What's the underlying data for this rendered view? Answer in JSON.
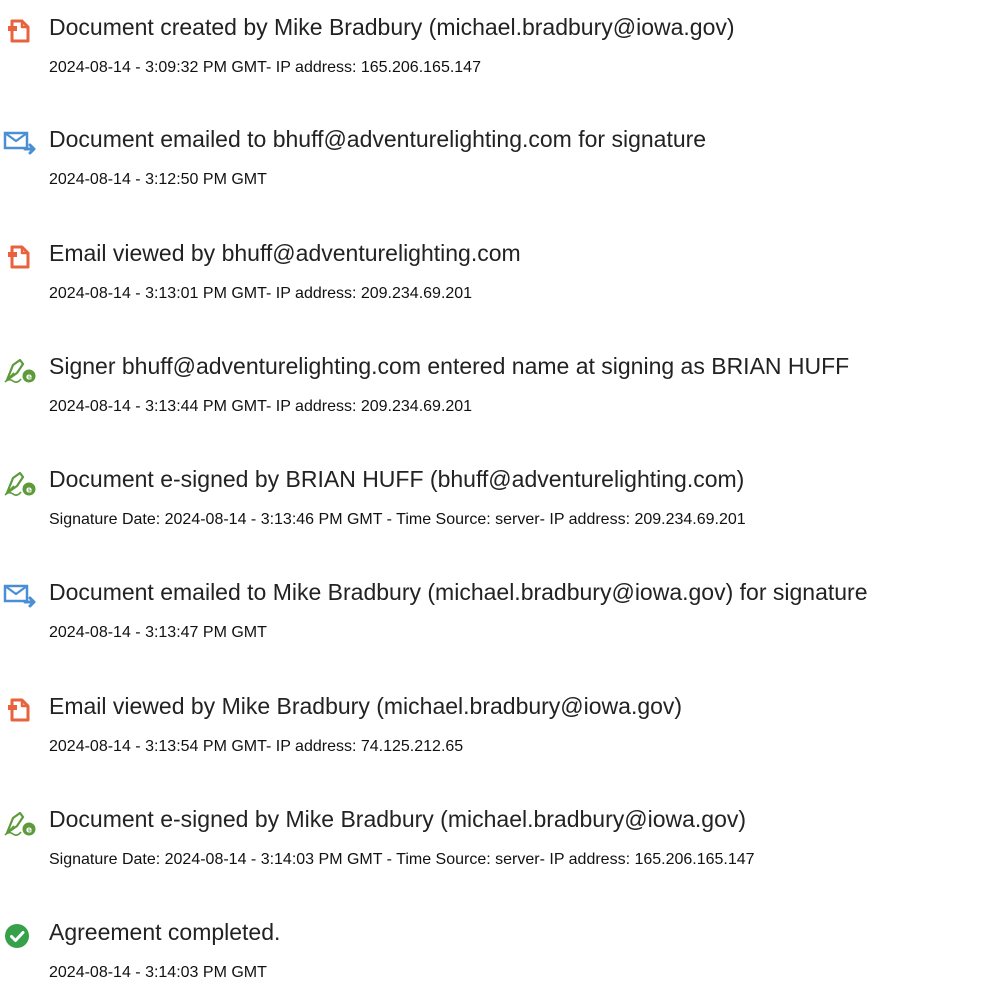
{
  "colors": {
    "doc_icon": "#e8623e",
    "email_icon": "#4a8fd6",
    "sign_icon": "#5c9a3a",
    "complete_icon": "#36a14a",
    "text": "#222222"
  },
  "entries": [
    {
      "icon": "document-icon",
      "title": "Document created by Mike Bradbury (michael.bradbury@iowa.gov)",
      "detail": "2024-08-14 - 3:09:32 PM GMT- IP address: 165.206.165.147"
    },
    {
      "icon": "email-icon",
      "title": "Document emailed to bhuff@adventurelighting.com for signature",
      "detail": "2024-08-14 - 3:12:50 PM GMT"
    },
    {
      "icon": "document-icon",
      "title": "Email viewed by bhuff@adventurelighting.com",
      "detail": "2024-08-14 - 3:13:01 PM GMT- IP address: 209.234.69.201"
    },
    {
      "icon": "signature-pen-icon",
      "title": "Signer bhuff@adventurelighting.com entered name at signing as BRIAN HUFF",
      "detail": "2024-08-14 - 3:13:44 PM GMT- IP address: 209.234.69.201"
    },
    {
      "icon": "signature-pen-icon",
      "title": "Document e-signed by BRIAN HUFF (bhuff@adventurelighting.com)",
      "detail": "Signature Date: 2024-08-14 - 3:13:46 PM GMT - Time Source: server- IP address: 209.234.69.201"
    },
    {
      "icon": "email-icon",
      "title": "Document emailed to Mike Bradbury (michael.bradbury@iowa.gov) for signature",
      "detail": "2024-08-14 - 3:13:47 PM GMT"
    },
    {
      "icon": "document-icon",
      "title": "Email viewed by Mike Bradbury (michael.bradbury@iowa.gov)",
      "detail": "2024-08-14 - 3:13:54 PM GMT- IP address: 74.125.212.65"
    },
    {
      "icon": "signature-pen-icon",
      "title": "Document e-signed by Mike Bradbury (michael.bradbury@iowa.gov)",
      "detail": "Signature Date: 2024-08-14 - 3:14:03 PM GMT - Time Source: server- IP address: 165.206.165.147"
    },
    {
      "icon": "check-circle-icon",
      "title": "Agreement completed.",
      "detail": "2024-08-14 - 3:14:03 PM GMT"
    }
  ]
}
